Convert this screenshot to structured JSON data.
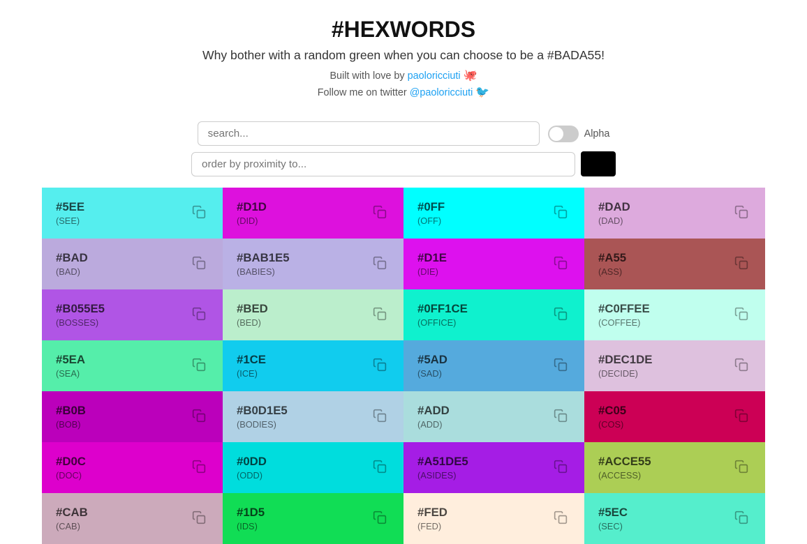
{
  "header": {
    "title": "#HEXWORDS",
    "tagline": "Why bother with a random green when you can choose to be a #BADA55!",
    "built_by_text": "Built with love by",
    "author_name": "paoloricciuti",
    "follow_text": "Follow me on twitter",
    "twitter_handle": "@paoloricciuti"
  },
  "controls": {
    "search_placeholder": "search...",
    "search_value": "",
    "alpha_label": "Alpha",
    "proximity_placeholder": "order by proximity to...",
    "proximity_value": "",
    "swatch_color": "#000000"
  },
  "colors": [
    {
      "hex": "#5EE",
      "code": "#5EE",
      "word": "SEE",
      "bg": "#55EEEE"
    },
    {
      "hex": "#D1D",
      "code": "#D1D",
      "word": "DID",
      "bg": "#DD11DD"
    },
    {
      "hex": "#0FF",
      "code": "#0FF",
      "word": "OFF",
      "bg": "#00FFFF"
    },
    {
      "hex": "#DAD",
      "code": "#DAD",
      "word": "DAD",
      "bg": "#DDAADD"
    },
    {
      "hex": "#BAD",
      "code": "#BAD",
      "word": "BAD",
      "bg": "#BBAADD"
    },
    {
      "hex": "#BAB1E5",
      "code": "#BAB1E5",
      "word": "BABIES",
      "bg": "#BAB1E5"
    },
    {
      "hex": "#D1E",
      "code": "#D1E",
      "word": "DIE",
      "bg": "#DD11EE"
    },
    {
      "hex": "#A55",
      "code": "#A55",
      "word": "ASS",
      "bg": "#AA5555"
    },
    {
      "hex": "#B055E5",
      "code": "#B055E5",
      "word": "BOSSES",
      "bg": "#B055E5"
    },
    {
      "hex": "#BED",
      "code": "#BED",
      "word": "BED",
      "bg": "#BBEECC"
    },
    {
      "hex": "#0FF1CE",
      "code": "#0FF1CE",
      "word": "OFFICE",
      "bg": "#0FF1CE"
    },
    {
      "hex": "#C0FFEE",
      "code": "#C0FFEE",
      "word": "COFFEE",
      "bg": "#C0FFEE"
    },
    {
      "hex": "#5EA",
      "code": "#5EA",
      "word": "SEA",
      "bg": "#55EEAA"
    },
    {
      "hex": "#1CE",
      "code": "#1CE",
      "word": "ICE",
      "bg": "#11CCEE"
    },
    {
      "hex": "#5AD",
      "code": "#5AD",
      "word": "SAD",
      "bg": "#55AADD"
    },
    {
      "hex": "#DEC1DE",
      "code": "#DEC1DE",
      "word": "DECIDE",
      "bg": "#DEC1DE"
    },
    {
      "hex": "#B0B",
      "code": "#B0B",
      "word": "BOB",
      "bg": "#BB00BB"
    },
    {
      "hex": "#B0D1E5",
      "code": "#B0D1E5",
      "word": "BODIES",
      "bg": "#B0D1E5"
    },
    {
      "hex": "#ADD",
      "code": "#ADD",
      "word": "ADD",
      "bg": "#AADDDD"
    },
    {
      "hex": "#C05",
      "code": "#C05",
      "word": "COS",
      "bg": "#CC0055"
    },
    {
      "hex": "#D0C",
      "code": "#D0C",
      "word": "DOC",
      "bg": "#DD00CC"
    },
    {
      "hex": "#0DD",
      "code": "#0DD",
      "word": "ODD",
      "bg": "#00DDDD"
    },
    {
      "hex": "#A51DE5",
      "code": "#A51DE5",
      "word": "ASIDES",
      "bg": "#A51DE5"
    },
    {
      "hex": "#ACCE55",
      "code": "#ACCE55",
      "word": "ACCESS",
      "bg": "#ACCE55"
    },
    {
      "hex": "#CAB",
      "code": "#CAB",
      "word": "CAB",
      "bg": "#CCAABB"
    },
    {
      "hex": "#1D5",
      "code": "#1D5",
      "word": "IDS",
      "bg": "#11DD55"
    },
    {
      "hex": "#FED",
      "code": "#FED",
      "word": "FED",
      "bg": "#FFEEDD"
    },
    {
      "hex": "#5EC",
      "code": "#5EC",
      "word": "SEC",
      "bg": "#55EECC"
    }
  ]
}
